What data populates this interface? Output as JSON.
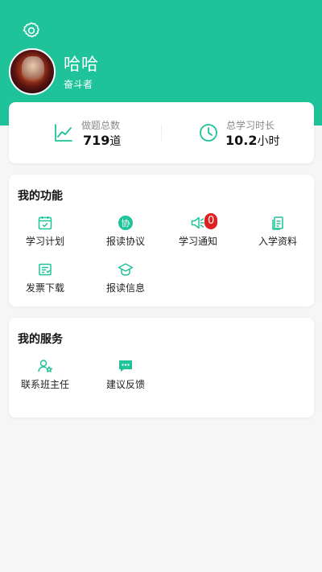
{
  "profile": {
    "name": "哈哈",
    "title": "奋斗者"
  },
  "stats": {
    "questions": {
      "label": "做题总数",
      "value": "719",
      "unit": "道"
    },
    "study_time": {
      "label": "总学习时长",
      "value": "10.2",
      "unit": "小时"
    }
  },
  "functions": {
    "title": "我的功能",
    "items": [
      {
        "label": "学习计划",
        "icon": "calendar-icon"
      },
      {
        "label": "报读协议",
        "icon": "agreement-icon"
      },
      {
        "label": "学习通知",
        "icon": "speaker-icon",
        "badge": "0"
      },
      {
        "label": "入学资料",
        "icon": "documents-icon"
      },
      {
        "label": "发票下载",
        "icon": "invoice-icon"
      },
      {
        "label": "报读信息",
        "icon": "graduation-cap-icon"
      }
    ]
  },
  "services": {
    "title": "我的服务",
    "items": [
      {
        "label": "联系班主任",
        "icon": "contact-teacher-icon"
      },
      {
        "label": "建议反馈",
        "icon": "feedback-icon"
      }
    ]
  },
  "colors": {
    "brand": "#1fc39a",
    "badge": "#e02020"
  }
}
